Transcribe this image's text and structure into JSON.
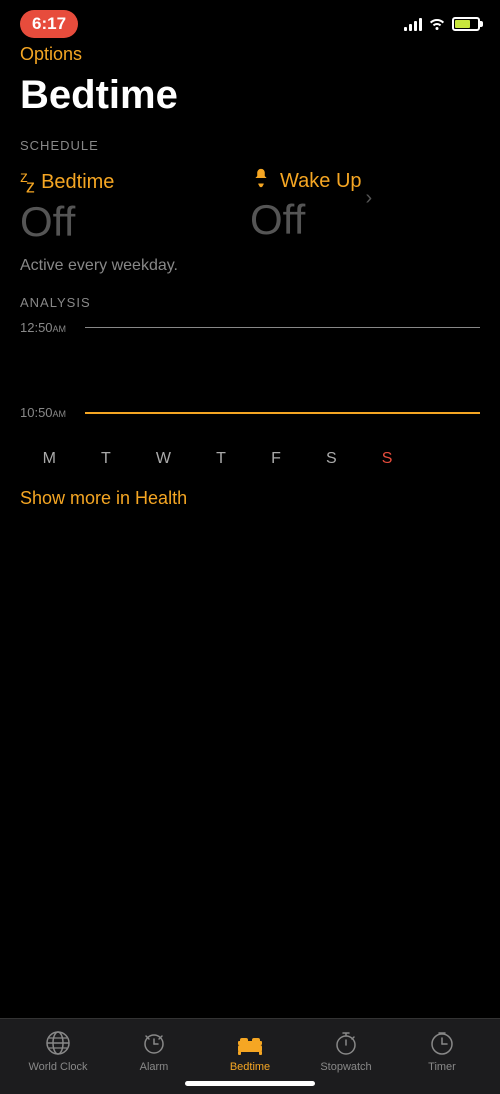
{
  "statusBar": {
    "time": "6:17",
    "battery": "70"
  },
  "header": {
    "optionsLabel": "Options",
    "title": "Bedtime"
  },
  "schedule": {
    "sectionLabel": "SCHEDULE",
    "bedtime": {
      "icon": "ᶻz",
      "label": "Bedtime",
      "value": "Off"
    },
    "wakeUp": {
      "icon": "🔔",
      "label": "Wake Up",
      "value": "Off"
    },
    "activeText": "Active every weekday."
  },
  "analysis": {
    "sectionLabel": "ANALYSIS",
    "topTime": "12:50",
    "topTimeSuffix": "AM",
    "bottomTime": "10:50",
    "bottomTimeSuffix": "AM",
    "days": [
      "M",
      "T",
      "W",
      "T",
      "F",
      "S",
      "S"
    ]
  },
  "showMoreLink": "Show more in Health",
  "tabBar": {
    "tabs": [
      {
        "label": "World Clock",
        "icon": "globe",
        "active": false
      },
      {
        "label": "Alarm",
        "icon": "alarm",
        "active": false
      },
      {
        "label": "Bedtime",
        "icon": "bed",
        "active": true
      },
      {
        "label": "Stopwatch",
        "icon": "stopwatch",
        "active": false
      },
      {
        "label": "Timer",
        "icon": "timer",
        "active": false
      }
    ]
  }
}
